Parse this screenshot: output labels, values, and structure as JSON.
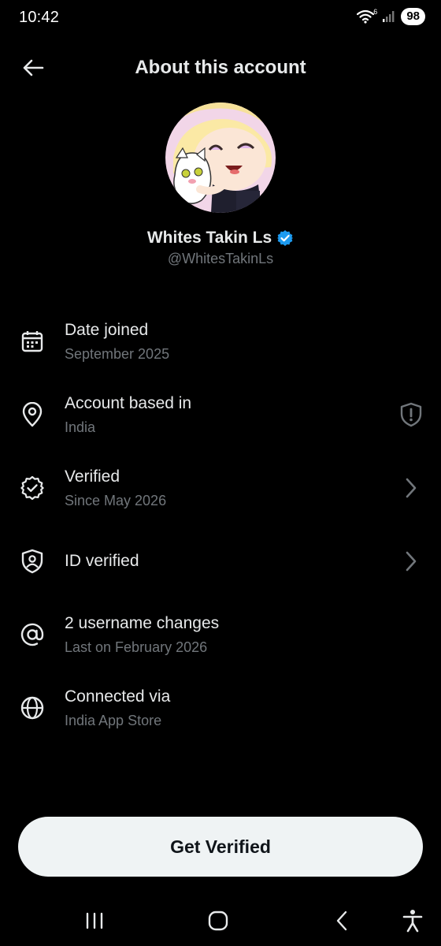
{
  "status_bar": {
    "time": "10:42",
    "network": "6",
    "battery": "98",
    "icons": [
      "wifi-icon",
      "signal-icon",
      "battery-icon"
    ]
  },
  "header": {
    "title": "About this account",
    "back_icon": "arrow-left-icon"
  },
  "profile": {
    "name": "Whites Takin Ls",
    "handle": "@WhitesTakinLs",
    "verified": true,
    "verified_color": "#1d9bf0"
  },
  "info_items": [
    {
      "icon": "calendar-icon",
      "title": "Date joined",
      "subtitle": "September 2025",
      "trailing": ""
    },
    {
      "icon": "location-pin-icon",
      "title": "Account based in",
      "subtitle": "India",
      "trailing": "shield-alert-icon"
    },
    {
      "icon": "verified-badge-icon",
      "title": "Verified",
      "subtitle": "Since May 2026",
      "trailing": "chevron-right-icon"
    },
    {
      "icon": "id-shield-icon",
      "title": "ID verified",
      "subtitle": "",
      "trailing": "chevron-right-icon"
    },
    {
      "icon": "at-sign-icon",
      "title": "2 username changes",
      "subtitle": "Last on February 2026",
      "trailing": ""
    },
    {
      "icon": "globe-icon",
      "title": "Connected via",
      "subtitle": "India App Store",
      "trailing": ""
    }
  ],
  "cta": {
    "label": "Get Verified"
  },
  "nav_bar": {
    "icons": [
      "recent-apps-icon",
      "home-icon",
      "back-icon",
      "accessibility-icon"
    ]
  },
  "colors": {
    "background": "#000000",
    "primary_text": "#e7e9ea",
    "secondary_text": "#71767b",
    "accent": "#1d9bf0",
    "button_bg": "#eff3f4"
  }
}
